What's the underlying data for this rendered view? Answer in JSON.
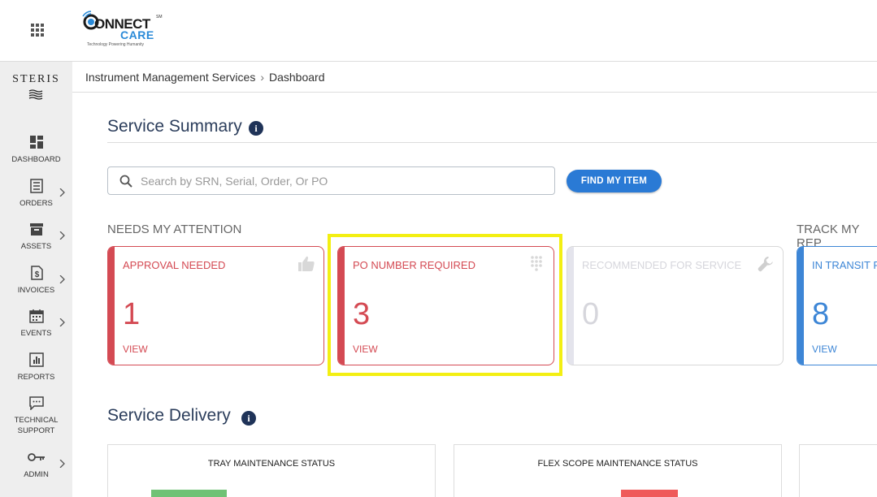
{
  "header": {
    "logo_connect": "ONNECT",
    "logo_c": "C",
    "logo_care": "CARE",
    "logo_tagline": "Technology Powering Humanity",
    "logo_sm": "SM"
  },
  "sidebar": {
    "brand": "STERIS",
    "items": [
      {
        "label": "Dashboard",
        "icon": "dashboard-icon",
        "has_chevron": false
      },
      {
        "label": "Orders",
        "icon": "orders-icon",
        "has_chevron": true
      },
      {
        "label": "Assets",
        "icon": "assets-icon",
        "has_chevron": true
      },
      {
        "label": "Invoices",
        "icon": "invoices-icon",
        "has_chevron": true
      },
      {
        "label": "Events",
        "icon": "events-icon",
        "has_chevron": true
      },
      {
        "label": "Reports",
        "icon": "reports-icon",
        "has_chevron": false
      },
      {
        "label": "Technical Support",
        "icon": "chat-icon",
        "has_chevron": false
      },
      {
        "label": "Admin",
        "icon": "key-icon",
        "has_chevron": true
      }
    ]
  },
  "breadcrumb": {
    "parent": "Instrument Management Services",
    "current": "Dashboard"
  },
  "service_summary": {
    "title": "Service Summary",
    "search_placeholder": "Search by SRN, Serial, Order, Or PO",
    "search_value": "",
    "find_button": "FIND MY ITEM"
  },
  "needs_attention": {
    "label": "NEEDS MY ATTENTION",
    "cards": [
      {
        "title": "APPROVAL NEEDED",
        "value": "1",
        "view": "VIEW",
        "icon": "thumbs-up-icon",
        "color": "#d44a53"
      },
      {
        "title": "PO NUMBER REQUIRED",
        "value": "3",
        "view": "VIEW",
        "icon": "keypad-icon",
        "color": "#d44a53"
      },
      {
        "title": "RECOMMENDED FOR SERVICE",
        "value": "0",
        "view": "",
        "icon": "wrench-icon",
        "color": "#d6d6dc"
      }
    ]
  },
  "track_repairs": {
    "label": "TRACK MY REP",
    "cards": [
      {
        "title": "IN TRANSIT F",
        "value": "8",
        "view": "VIEW",
        "color": "#3d86d6"
      }
    ]
  },
  "service_delivery": {
    "title": "Service Delivery",
    "cards": [
      {
        "title": "TRAY MAINTENANCE STATUS",
        "bar_color": "#6fc275"
      },
      {
        "title": "FLEX SCOPE MAINTENANCE STATUS",
        "bar_color": "#ef5a5a"
      }
    ]
  },
  "colors": {
    "accent_blue": "#2a7ad5",
    "alert_red": "#d44a53",
    "highlight_yellow": "#f3ef12",
    "title_navy": "#2c3e5c"
  }
}
